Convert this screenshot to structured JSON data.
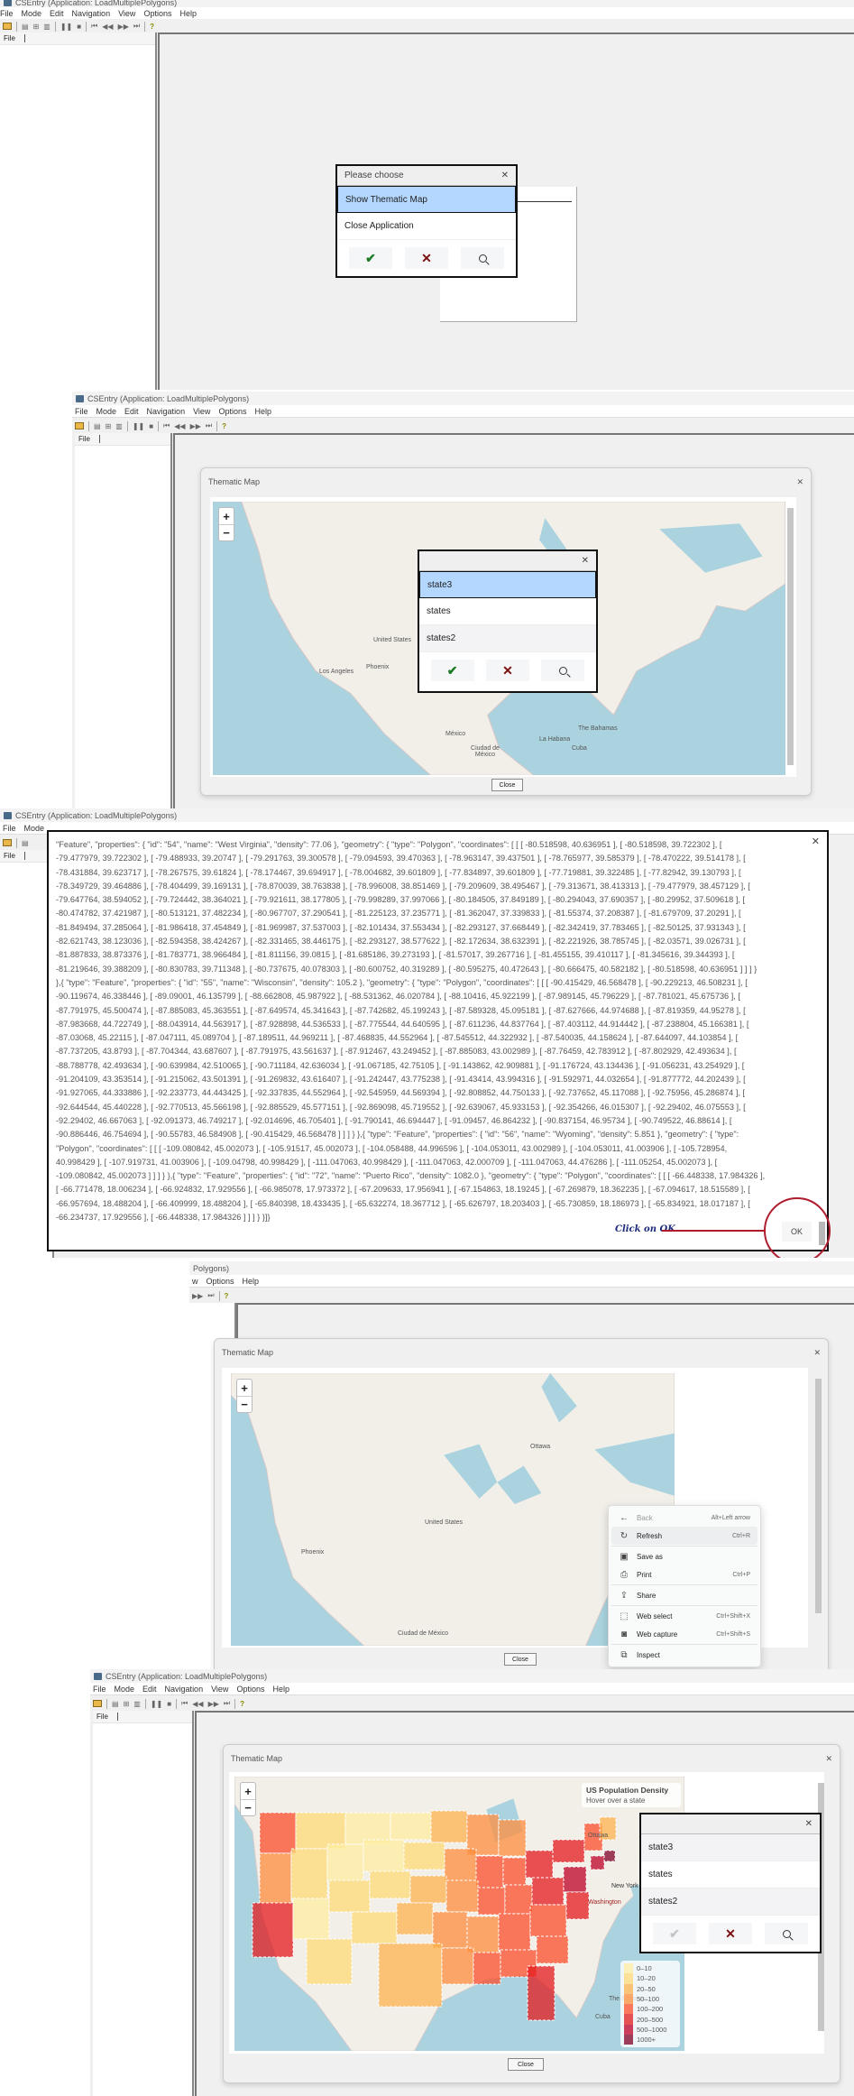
{
  "app": {
    "title": "CSEntry (Application: LoadMultiplePolygons)",
    "menu": [
      "File",
      "Mode",
      "Edit",
      "Navigation",
      "View",
      "Options",
      "Help"
    ],
    "file_tab": "File"
  },
  "step1": {
    "dialog_title": "Please choose",
    "options": [
      "Show Thematic Map",
      "Close Application"
    ],
    "selected_index": 0
  },
  "step2": {
    "dialog_title": "Thematic Map",
    "close_label": "Close",
    "choices": [
      "state3",
      "states",
      "states2"
    ],
    "selected_index": 0,
    "map_labels": [
      "Los Angeles",
      "Phoenix",
      "United States",
      "México",
      "Ciudad de México",
      "La Habana",
      "The Bahamas",
      "Cuba"
    ]
  },
  "step3": {
    "json_lines": [
      "\"Feature\", \"properties\": { \"id\": \"54\", \"name\": \"West Virginia\", \"density\": 77.06 }, \"geometry\": { \"type\": \"Polygon\", \"coordinates\": [ [ [ -80.518598, 40.636951 ], [ -80.518598, 39.722302 ], [",
      "-79.477979, 39.722302 ], [ -79.488933, 39.20747 ], [ -79.291763, 39.300578 ], [ -79.094593, 39.470363 ], [ -78.963147, 39.437501 ], [ -78.765977, 39.585379 ], [ -78.470222, 39.514178 ], [",
      "-78.431884, 39.623717 ], [ -78.267575, 39.61824 ], [ -78.174467, 39.694917 ], [ -78.004682, 39.601809 ], [ -77.834897, 39.601809 ], [ -77.719881, 39.322485 ], [ -77.82942, 39.130793 ], [",
      "-78.349729, 39.464886 ], [ -78.404499, 39.169131 ], [ -78.870039, 38.763838 ], [ -78.996008, 38.851469 ], [ -79.209609, 38.495467 ], [ -79.313671, 38.413313 ], [ -79.477979, 38.457129 ], [",
      "-79.647764, 38.594052 ], [ -79.724442, 38.364021 ], [ -79.921611, 38.177805 ], [ -79.998289, 37.997066 ], [ -80.184505, 37.849189 ], [ -80.294043, 37.690357 ], [ -80.29952, 37.509618 ], [",
      "-80.474782, 37.421987 ], [ -80.513121, 37.482234 ], [ -80.967707, 37.290541 ], [ -81.225123, 37.235771 ], [ -81.362047, 37.339833 ], [ -81.55374, 37.208387 ], [ -81.679709, 37.20291 ], [",
      "-81.849494, 37.285064 ], [ -81.986418, 37.454849 ], [ -81.969987, 37.537003 ], [ -82.101434, 37.553434 ], [ -82.293127, 37.668449 ], [ -82.342419, 37.783465 ], [ -82.50125, 37.931343 ], [",
      "-82.621743, 38.123036 ], [ -82.594358, 38.424267 ], [ -82.331465, 38.446175 ], [ -82.293127, 38.577622 ], [ -82.172634, 38.632391 ], [ -82.221926, 38.785745 ], [ -82.03571, 39.026731 ], [",
      "-81.887833, 38.873376 ], [ -81.783771, 38.966484 ], [ -81.811156, 39.0815 ], [ -81.685186, 39.273193 ], [ -81.57017, 39.267716 ], [ -81.455155, 39.410117 ], [ -81.345616, 39.344393 ], [",
      "-81.219646, 39.388209 ], [ -80.830783, 39.711348 ], [ -80.737675, 40.078303 ], [ -80.600752, 40.319289 ], [ -80.595275, 40.472643 ], [ -80.666475, 40.582182 ], [ -80.518598, 40.636951 ] ] ] }",
      "},{ \"type\": \"Feature\", \"properties\": { \"id\": \"55\", \"name\": \"Wisconsin\", \"density\": 105.2 }, \"geometry\": { \"type\": \"Polygon\", \"coordinates\": [ [ [ -90.415429, 46.568478 ], [ -90.229213, 46.508231 ], [",
      "-90.119674, 46.338446 ], [ -89.09001, 46.135799 ], [ -88.662808, 45.987922 ], [ -88.531362, 46.020784 ], [ -88.10416, 45.922199 ], [ -87.989145, 45.796229 ], [ -87.781021, 45.675736 ], [",
      "-87.791975, 45.500474 ], [ -87.885083, 45.363551 ], [ -87.649574, 45.341643 ], [ -87.742682, 45.199243 ], [ -87.589328, 45.095181 ], [ -87.627666, 44.974688 ], [ -87.819359, 44.95278 ], [",
      "-87.983668, 44.722749 ], [ -88.043914, 44.563917 ], [ -87.928898, 44.536533 ], [ -87.775544, 44.640595 ], [ -87.611236, 44.837764 ], [ -87.403112, 44.914442 ], [ -87.238804, 45.166381 ], [",
      "-87.03068, 45.22115 ], [ -87.047111, 45.089704 ], [ -87.189511, 44.969211 ], [ -87.468835, 44.552964 ], [ -87.545512, 44.322932 ], [ -87.540035, 44.158624 ], [ -87.644097, 44.103854 ], [",
      "-87.737205, 43.8793 ], [ -87.704344, 43.687607 ], [ -87.791975, 43.561637 ], [ -87.912467, 43.249452 ], [ -87.885083, 43.002989 ], [ -87.76459, 42.783912 ], [ -87.802929, 42.493634 ], [",
      "-88.788778, 42.493634 ], [ -90.639984, 42.510065 ], [ -90.711184, 42.636034 ], [ -91.067185, 42.75105 ], [ -91.143862, 42.909881 ], [ -91.176724, 43.134436 ], [ -91.056231, 43.254929 ], [",
      "-91.204109, 43.353514 ], [ -91.215062, 43.501391 ], [ -91.269832, 43.616407 ], [ -91.242447, 43.775238 ], [ -91.43414, 43.994316 ], [ -91.592971, 44.032654 ], [ -91.877772, 44.202439 ], [",
      "-91.927065, 44.333886 ], [ -92.233773, 44.443425 ], [ -92.337835, 44.552964 ], [ -92.545959, 44.569394 ], [ -92.808852, 44.750133 ], [ -92.737652, 45.117088 ], [ -92.75956, 45.286874 ], [",
      "-92.644544, 45.440228 ], [ -92.770513, 45.566198 ], [ -92.885529, 45.577151 ], [ -92.869098, 45.719552 ], [ -92.639067, 45.933153 ], [ -92.354266, 46.015307 ], [ -92.29402, 46.075553 ], [",
      "-92.29402, 46.667063 ], [ -92.091373, 46.749217 ], [ -92.014696, 46.705401 ], [ -91.790141, 46.694447 ], [ -91.09457, 46.864232 ], [ -90.837154, 46.95734 ], [ -90.749522, 46.88614 ], [",
      "-90.886446, 46.754694 ], [ -90.55783, 46.584908 ], [ -90.415429, 46.568478 ] ] ] } },{ \"type\": \"Feature\", \"properties\": { \"id\": \"56\", \"name\": \"Wyoming\", \"density\": 5.851 }, \"geometry\": { \"type\":",
      "\"Polygon\", \"coordinates\": [ [ [ -109.080842, 45.002073 ], [ -105.91517, 45.002073 ], [ -104.058488, 44.996596 ], [ -104.053011, 43.002989 ], [ -104.053011, 41.003906 ], [ -105.728954,",
      "40.998429 ], [ -107.919731, 41.003906 ], [ -109.04798, 40.998429 ], [ -111.047063, 40.998429 ], [ -111.047063, 42.000709 ], [ -111.047063, 44.476286 ], [ -111.05254, 45.002073 ], [",
      "-109.080842, 45.002073 ] ] ] } },{ \"type\": \"Feature\", \"properties\": { \"id\": \"72\", \"name\": \"Puerto Rico\", \"density\": 1082.0 }, \"geometry\": { \"type\": \"Polygon\", \"coordinates\": [ [ [ -66.448338, 17.984326 ],",
      "[ -66.771478, 18.006234 ], [ -66.924832, 17.929556 ], [ -66.985078, 17.973372 ], [ -67.209633, 17.956941 ], [ -67.154863, 18.19245 ], [ -67.269879, 18.362235 ], [ -67.094617, 18.515589 ], [",
      "-66.957694, 18.488204 ], [ -66.409999, 18.488204 ], [ -65.840398, 18.433435 ], [ -65.632274, 18.367712 ], [ -65.626797, 18.203403 ], [ -65.730859, 18.186973 ], [ -65.834921, 18.017187 ], [",
      "-66.234737, 17.929556 ], [ -66.448338, 17.984326 ] ] ] } }]}"
    ],
    "ok_label": "OK",
    "annotation": "Click on OK",
    "annotation_color": "#b01c2e"
  },
  "step4": {
    "title_partial": "Polygons)",
    "menu_partial": [
      "w",
      "Options",
      "Help"
    ],
    "map_labels": [
      "Ottawa",
      "United States",
      "Phoenix",
      "Ciudad de México"
    ],
    "context_menu": [
      {
        "icon": "back-arrow-icon",
        "glyph": "←",
        "label": "Back",
        "shortcut": "Alt+Left arrow",
        "disabled": true
      },
      {
        "icon": "refresh-icon",
        "glyph": "↻",
        "label": "Refresh",
        "shortcut": "Ctrl+R",
        "highlighted": true
      },
      {
        "icon": "save-as-icon",
        "glyph": "▣",
        "label": "Save as",
        "shortcut": ""
      },
      {
        "icon": "print-icon",
        "glyph": "⎙",
        "label": "Print",
        "shortcut": "Ctrl+P"
      },
      {
        "icon": "share-icon",
        "glyph": "⇪",
        "label": "Share",
        "shortcut": ""
      },
      {
        "icon": "web-select-icon",
        "glyph": "⬚",
        "label": "Web select",
        "shortcut": "Ctrl+Shift+X"
      },
      {
        "icon": "web-capture-icon",
        "glyph": "◙",
        "label": "Web capture",
        "shortcut": "Ctrl+Shift+S"
      },
      {
        "icon": "inspect-icon",
        "glyph": "⧉",
        "label": "Inspect",
        "shortcut": ""
      }
    ]
  },
  "step5": {
    "info_title": "US Population Density",
    "info_hint": "Hover over a state",
    "map_labels": [
      "Ottawa",
      "New York",
      "Washington",
      "The Bahamas",
      "Cuba"
    ],
    "legend": [
      {
        "label": "0–10",
        "color": "#FFEDA0"
      },
      {
        "label": "10–20",
        "color": "#FED976"
      },
      {
        "label": "20–50",
        "color": "#FEB24C"
      },
      {
        "label": "50–100",
        "color": "#FD8D3C"
      },
      {
        "label": "100–200",
        "color": "#FC4E2A"
      },
      {
        "label": "200–500",
        "color": "#E31A1C"
      },
      {
        "label": "500–1000",
        "color": "#BD0026"
      },
      {
        "label": "1000+",
        "color": "#800026"
      }
    ],
    "confirm_disabled": true
  },
  "colors": {
    "selection": "#b3d7ff",
    "water": "#aad3df",
    "land": "#f2efe9"
  }
}
